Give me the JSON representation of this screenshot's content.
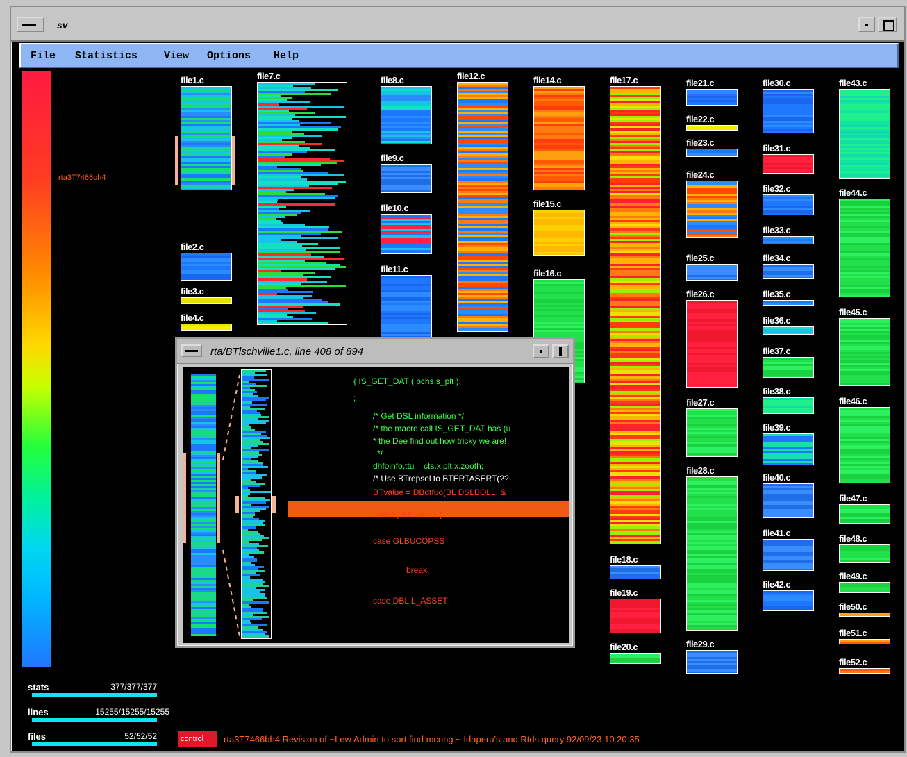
{
  "window": {
    "title": "sv"
  },
  "menu": {
    "items": [
      "File",
      "Statistics",
      "View",
      "Options",
      "Help"
    ]
  },
  "scale": {
    "marker_label": "rta3T7466bh4"
  },
  "files": [
    {
      "name": "file1.c"
    },
    {
      "name": "file2.c"
    },
    {
      "name": "file3.c"
    },
    {
      "name": "file4.c"
    },
    {
      "name": "file7.c"
    },
    {
      "name": "file8.c"
    },
    {
      "name": "file9.c"
    },
    {
      "name": "file10.c"
    },
    {
      "name": "file11.c"
    },
    {
      "name": "file12.c"
    },
    {
      "name": "file14.c"
    },
    {
      "name": "file15.c"
    },
    {
      "name": "file16.c"
    },
    {
      "name": "file17.c"
    },
    {
      "name": "file18.c"
    },
    {
      "name": "file19.c"
    },
    {
      "name": "file20.c"
    },
    {
      "name": "file21.c"
    },
    {
      "name": "file22.c"
    },
    {
      "name": "file23.c"
    },
    {
      "name": "file24.c"
    },
    {
      "name": "file25.c"
    },
    {
      "name": "file26.c"
    },
    {
      "name": "file27.c"
    },
    {
      "name": "file28.c"
    },
    {
      "name": "file29.c"
    },
    {
      "name": "file30.c"
    },
    {
      "name": "file31.c"
    },
    {
      "name": "file32.c"
    },
    {
      "name": "file33.c"
    },
    {
      "name": "file34.c"
    },
    {
      "name": "file35.c"
    },
    {
      "name": "file36.c"
    },
    {
      "name": "file37.c"
    },
    {
      "name": "file38.c"
    },
    {
      "name": "file39.c"
    },
    {
      "name": "file40.c"
    },
    {
      "name": "file41.c"
    },
    {
      "name": "file42.c"
    },
    {
      "name": "file43.c"
    },
    {
      "name": "file44.c"
    },
    {
      "name": "file45.c"
    },
    {
      "name": "file46.c"
    },
    {
      "name": "file47.c"
    },
    {
      "name": "file48.c"
    },
    {
      "name": "file49.c"
    },
    {
      "name": "file50.c"
    },
    {
      "name": "file51.c"
    },
    {
      "name": "file52.c"
    }
  ],
  "popup": {
    "title": "rta/BTlschville1.c, line 408 of 894",
    "code_lines": [
      "{  IS_GET_DAT ( pchs,s_plt );",
      ";",
      "/* Get DSL information */",
      "/* the macro call IS_GET_DAT has (u",
      "* the  Dee  find out how tricky we are!",
      "*/",
      "dhfoinfo,ttu  = cts.x.plt.x.zooth;",
      "/* Use BTrepsel to BTERTASERT(??",
      "BTvalue = DBdtfuo(BL DSLBOLL, &",
      "switch( BTvalue ) {",
      "case GLBUCOPSS",
      "break;",
      "case DBL L_ASSET"
    ]
  },
  "stats": [
    {
      "label": "stats",
      "value": "377/377/377"
    },
    {
      "label": "lines",
      "value": "15255/15255/15255"
    },
    {
      "label": "files",
      "value": "52/52/52"
    }
  ],
  "status": {
    "chip": "control",
    "text": "rta3T7466bh4   Revision of ~Lew Admin to sort find mcong  ~ Idaperu's and Rtds query 92/09/23 10:20:35"
  },
  "colors": {
    "menubar": "#8fb6f4",
    "highlight": "#f4b391",
    "selected_line": "#f05a14",
    "stat_bar": "#0de6f0",
    "status_chip": "#e0182a"
  }
}
